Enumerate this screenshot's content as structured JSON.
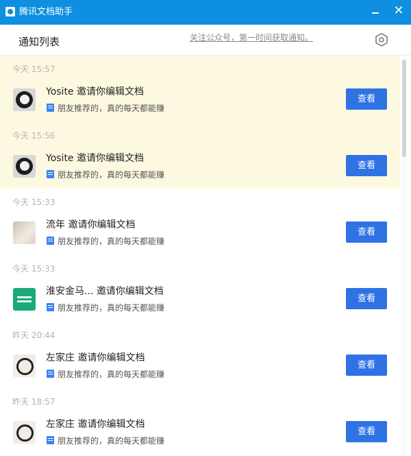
{
  "window": {
    "title": "腾讯文档助手",
    "icon": "tencent-docs-icon",
    "controls": {
      "minimize_icon": "minimize-icon",
      "close_icon": "close-icon",
      "close_glyph": "✕"
    }
  },
  "header": {
    "title": "通知列表",
    "follow_text": "关注公众号，第一时间获取通知。",
    "settings_icon": "settings-hexagon-icon"
  },
  "colors": {
    "title_bar": "#0f8fe0",
    "button": "#2f72e4",
    "highlight": "#fdf9e0"
  },
  "notifications": [
    {
      "time": "今天 15:57",
      "sender": "Yosite",
      "action": "邀请你编辑文档",
      "doc_title": "朋友推荐的，真的每天都能赚",
      "button_label": "查看",
      "avatar": "panda-avatar",
      "unread": true
    },
    {
      "time": "今天 15:56",
      "sender": "Yosite",
      "action": "邀请你编辑文档",
      "doc_title": "朋友推荐的，真的每天都能赚",
      "button_label": "查看",
      "avatar": "panda-avatar",
      "unread": true
    },
    {
      "time": "今天 15:33",
      "sender": "流年",
      "action": "邀请你编辑文档",
      "doc_title": "朋友推荐的，真的每天都能赚",
      "button_label": "查看",
      "avatar": "paper-avatar",
      "unread": false
    },
    {
      "time": "今天 15:33",
      "sender": "淮安金马...",
      "action": "邀请你编辑文档",
      "doc_title": "朋友推荐的，真的每天都能赚",
      "button_label": "查看",
      "avatar": "green-avatar",
      "unread": false
    },
    {
      "time": "昨天 20:44",
      "sender": "左家庄",
      "action": "邀请你编辑文档",
      "doc_title": "朋友推荐的，真的每天都能赚",
      "button_label": "查看",
      "avatar": "circle-avatar",
      "unread": false
    },
    {
      "time": "昨天 18:57",
      "sender": "左家庄",
      "action": "邀请你编辑文档",
      "doc_title": "朋友推荐的，真的每天都能赚",
      "button_label": "查看",
      "avatar": "circle-avatar",
      "unread": false
    }
  ]
}
